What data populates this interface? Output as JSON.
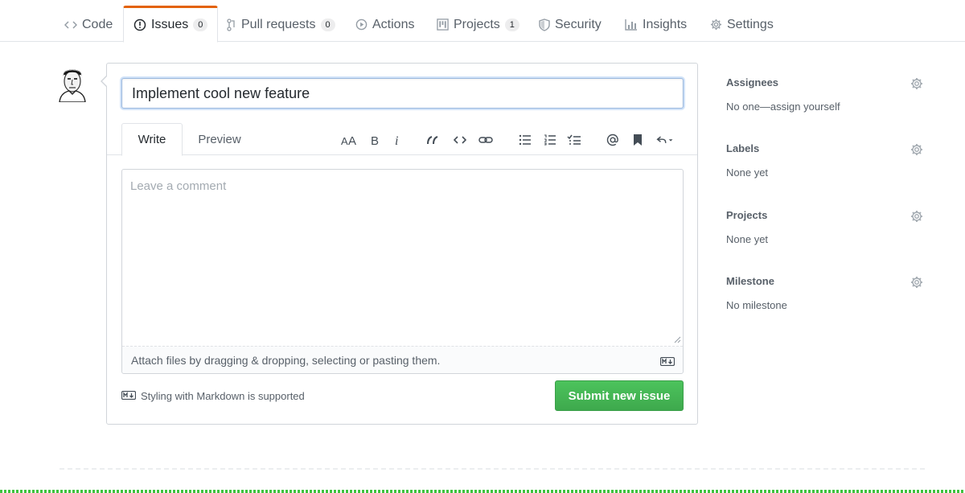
{
  "repo_nav": {
    "tabs": [
      {
        "label": "Code",
        "icon": "code-icon",
        "counter": null
      },
      {
        "label": "Issues",
        "icon": "issue-opened-icon",
        "counter": "0"
      },
      {
        "label": "Pull requests",
        "icon": "git-pull-request-icon",
        "counter": "0"
      },
      {
        "label": "Actions",
        "icon": "play-icon",
        "counter": null
      },
      {
        "label": "Projects",
        "icon": "project-icon",
        "counter": "1"
      },
      {
        "label": "Security",
        "icon": "shield-icon",
        "counter": null
      },
      {
        "label": "Insights",
        "icon": "graph-icon",
        "counter": null
      },
      {
        "label": "Settings",
        "icon": "gear-icon",
        "counter": null
      }
    ],
    "selected": "Issues"
  },
  "issue_form": {
    "title_value": "Implement cool new feature",
    "tabs": {
      "write": "Write",
      "preview": "Preview"
    },
    "comment_placeholder": "Leave a comment",
    "attach_text": "Attach files by dragging & dropping, selecting or pasting them.",
    "markdown_note": "Styling with Markdown is supported",
    "submit_label": "Submit new issue"
  },
  "toolbar_icons": [
    "text-size-icon",
    "bold-icon",
    "italic-icon",
    "quote-icon",
    "code-icon",
    "link-icon",
    "unordered-list-icon",
    "ordered-list-icon",
    "task-list-icon",
    "mention-icon",
    "bookmark-icon",
    "reply-icon"
  ],
  "sidebar": {
    "sections": [
      {
        "heading": "Assignees",
        "value": "No one—assign yourself"
      },
      {
        "heading": "Labels",
        "value": "None yet"
      },
      {
        "heading": "Projects",
        "value": "None yet"
      },
      {
        "heading": "Milestone",
        "value": "No milestone"
      }
    ]
  },
  "colors": {
    "accent_tab": "#e36209",
    "submit_green": "#3ea94d",
    "focus_border": "#9ab8de"
  }
}
